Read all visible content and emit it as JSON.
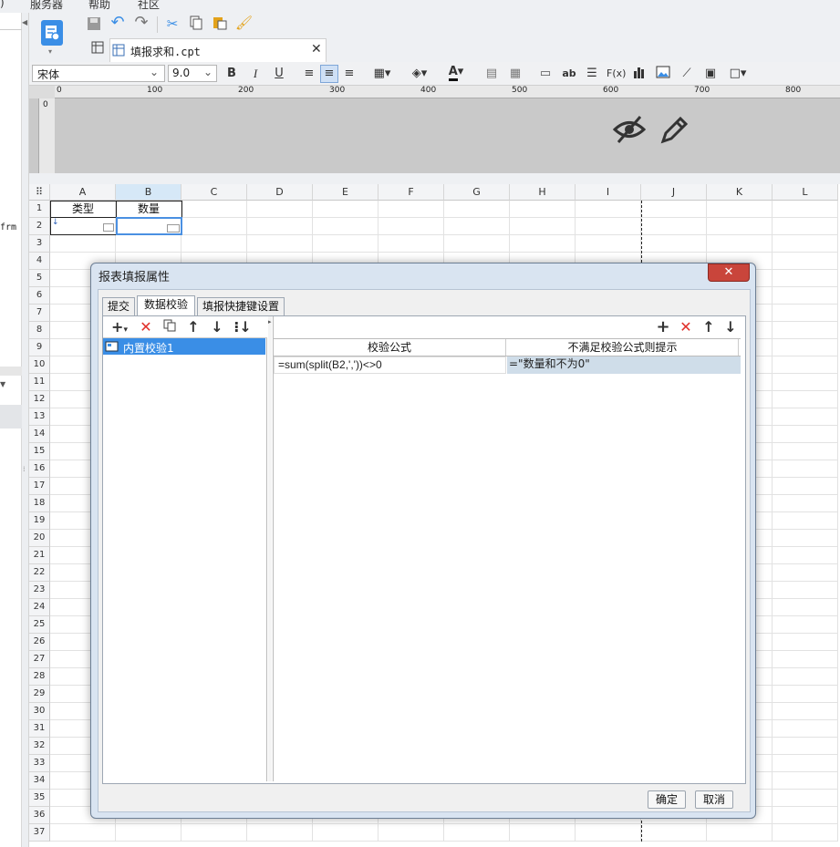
{
  "menubar": {
    "items": [
      "服务器",
      "帮助",
      "社区"
    ]
  },
  "left_strip": {
    "label": "frm"
  },
  "file_tab": {
    "title": "填报求和.cpt"
  },
  "format_bar": {
    "font": "宋体",
    "size": "9.0",
    "bold": "B",
    "italic": "I",
    "underline": "U"
  },
  "ruler": {
    "ticks": [
      "0",
      "100",
      "200",
      "300",
      "400",
      "500",
      "600",
      "700",
      "800"
    ]
  },
  "grid": {
    "columns": [
      "A",
      "B",
      "C",
      "D",
      "E",
      "F",
      "G",
      "H",
      "I",
      "J",
      "K",
      "L"
    ],
    "rows": [
      "1",
      "2",
      "3",
      "4",
      "5",
      "6",
      "7",
      "8",
      "9",
      "10",
      "11",
      "12",
      "13",
      "14",
      "15",
      "16",
      "17",
      "18",
      "19",
      "20",
      "21",
      "22",
      "23",
      "24",
      "25",
      "26",
      "27",
      "28",
      "29",
      "30",
      "31",
      "32",
      "33",
      "34",
      "35",
      "36",
      "37"
    ],
    "a1": "类型",
    "b1": "数量"
  },
  "dialog": {
    "title": "报表填报属性",
    "tabs": [
      "提交",
      "数据校验",
      "填报快捷键设置"
    ],
    "list_items": [
      "内置校验1"
    ],
    "table_headers": [
      "校验公式",
      "不满足校验公式则提示"
    ],
    "rows": [
      {
        "formula": "=sum(split(B2,','))<>0",
        "message": "=\"数量和不为0\""
      }
    ],
    "ok_label": "确定",
    "cancel_label": "取消"
  },
  "colors": {
    "accent": "#3a8ee6",
    "selection": "#4a90e2",
    "dialog_bg": "#d9e4f1",
    "close_red": "#c9453b"
  }
}
